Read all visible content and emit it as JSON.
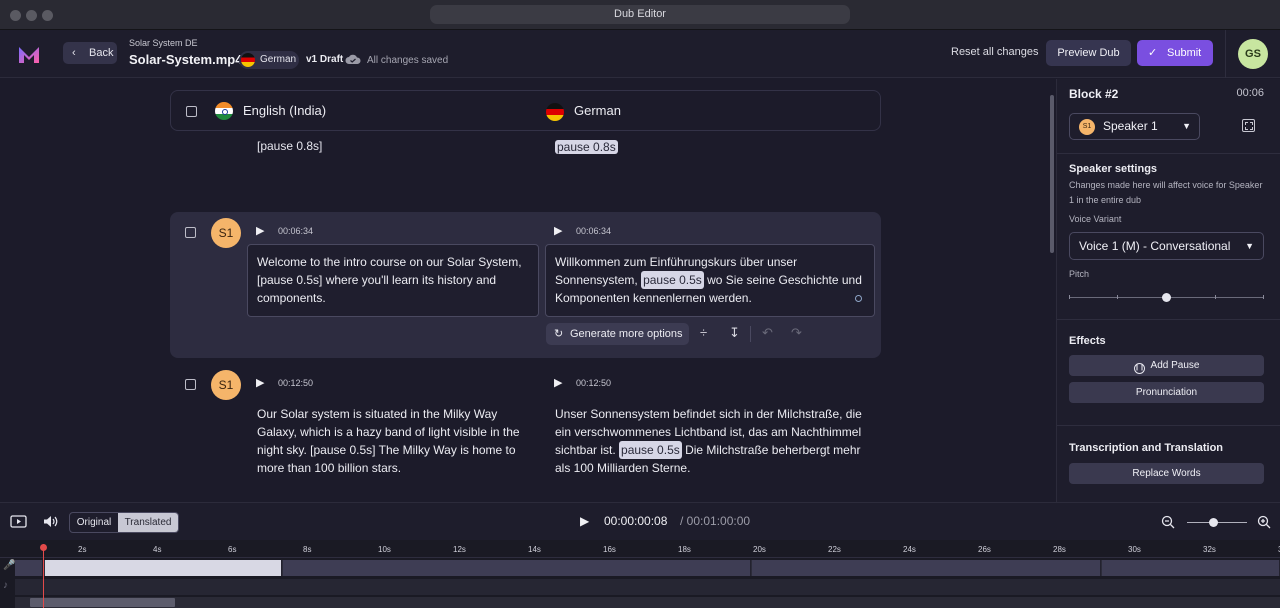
{
  "window": {
    "title": "Dub Editor"
  },
  "header": {
    "back_label": "Back",
    "project_sub": "Solar System DE",
    "file_name": "Solar-System.mp4",
    "language": "German",
    "draft": "v1 Draft",
    "save_status": "All changes saved",
    "reset_label": "Reset all changes",
    "preview_label": "Preview Dub",
    "submit_label": "Submit",
    "avatar_initials": "GS",
    "accent_color": "#7a4fe0"
  },
  "columns": {
    "source": "English (India)",
    "target": "German"
  },
  "rows": [
    {
      "source_text": "[pause 0.8s]",
      "target_pause": "pause 0.8s"
    },
    {
      "speaker": "S1",
      "source_time": "00:06:34",
      "target_time": "00:06:34",
      "source_text": "Welcome to the intro course on our Solar System, [pause 0.5s] where you'll learn its history and components.",
      "target_before": "Willkommen zum Einführungskurs über unser Sonnensystem,",
      "target_pause": "pause 0.5s",
      "target_after": "wo Sie seine Geschichte und Komponenten kennenlernen werden.",
      "generate_label": "Generate more options"
    },
    {
      "speaker": "S1",
      "source_time": "00:12:50",
      "target_time": "00:12:50",
      "source_text": "Our Solar system is situated in the Milky Way Galaxy, which is a hazy band of light visible in the night sky. [pause 0.5s] The Milky Way is home to more than 100 billion stars.",
      "target_before": "Unser Sonnensystem befindet sich in der Milchstraße, die ein verschwommenes Lichtband ist, das am Nachthimmel sichtbar ist.",
      "target_pause": "pause 0.5s",
      "target_after": "Die Milchstraße beherbergt mehr als 100 Milliarden Sterne."
    }
  ],
  "panel": {
    "block_title": "Block #2",
    "block_time": "00:06",
    "speaker_badge": "S1",
    "speaker": "Speaker 1",
    "speaker_settings": "Speaker settings",
    "speaker_note": "Changes made here will affect voice for Speaker 1 in the entire dub",
    "voice_variant_label": "Voice Variant",
    "voice_variant": "Voice 1 (M) - Conversational",
    "pitch_label": "Pitch",
    "pitch_level": 0.5,
    "effects": "Effects",
    "add_pause": "Add Pause",
    "pronunciation": "Pronunciation",
    "transcription_title": "Transcription and Translation",
    "replace_words": "Replace Words"
  },
  "transport": {
    "original": "Original",
    "translated": "Translated",
    "current_time": "00:00:00:08",
    "total_time": "/ 00:01:00:00"
  },
  "timeline": {
    "ticks": [
      "2s",
      "4s",
      "6s",
      "8s",
      "10s",
      "12s",
      "14s",
      "16s",
      "18s",
      "20s",
      "22s",
      "24s",
      "26s",
      "28s",
      "30s",
      "32s",
      "3"
    ]
  }
}
